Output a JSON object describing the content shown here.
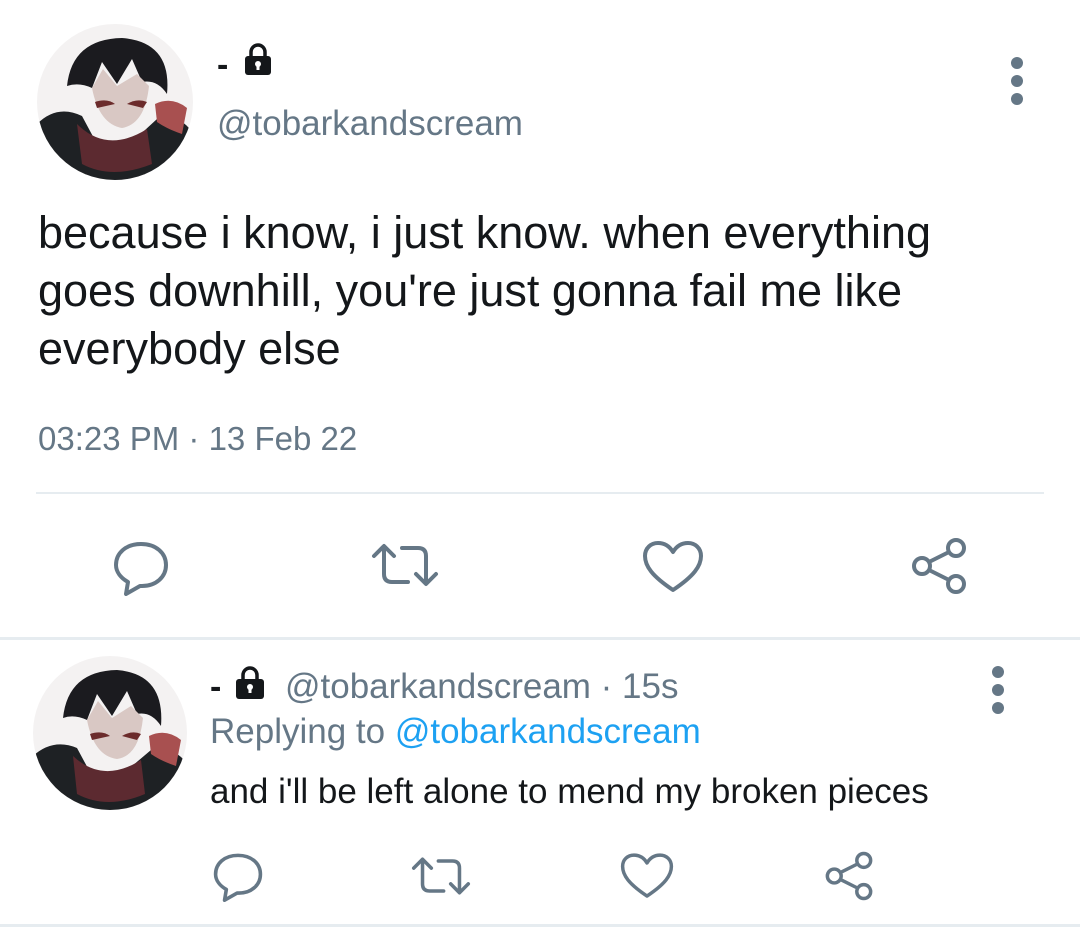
{
  "main_tweet": {
    "display_name": "-",
    "lock_icon": "lock-icon",
    "handle": "@tobarkandscream",
    "text": "because i know, i just know. when everything goes downhill, you're just gonna fail me like everybody else",
    "timestamp": "03:23 PM · 13 Feb 22",
    "more_icon": "more-vertical-icon",
    "actions": [
      "reply-icon",
      "retweet-icon",
      "like-icon",
      "share-icon"
    ]
  },
  "reply_tweet": {
    "display_name": "-",
    "lock_icon": "lock-icon",
    "handle_time": "@tobarkandscream · 15s",
    "replying_prefix": "Replying to ",
    "replying_handle": "@tobarkandscream",
    "text": "and i'll be left alone to mend my broken pieces",
    "more_icon": "more-vertical-icon",
    "actions": [
      "reply-icon",
      "retweet-icon",
      "like-icon",
      "share-icon"
    ]
  },
  "colors": {
    "text": "#14171a",
    "secondary": "#657786",
    "link": "#1da1f2",
    "divider": "#e6ecf0"
  }
}
